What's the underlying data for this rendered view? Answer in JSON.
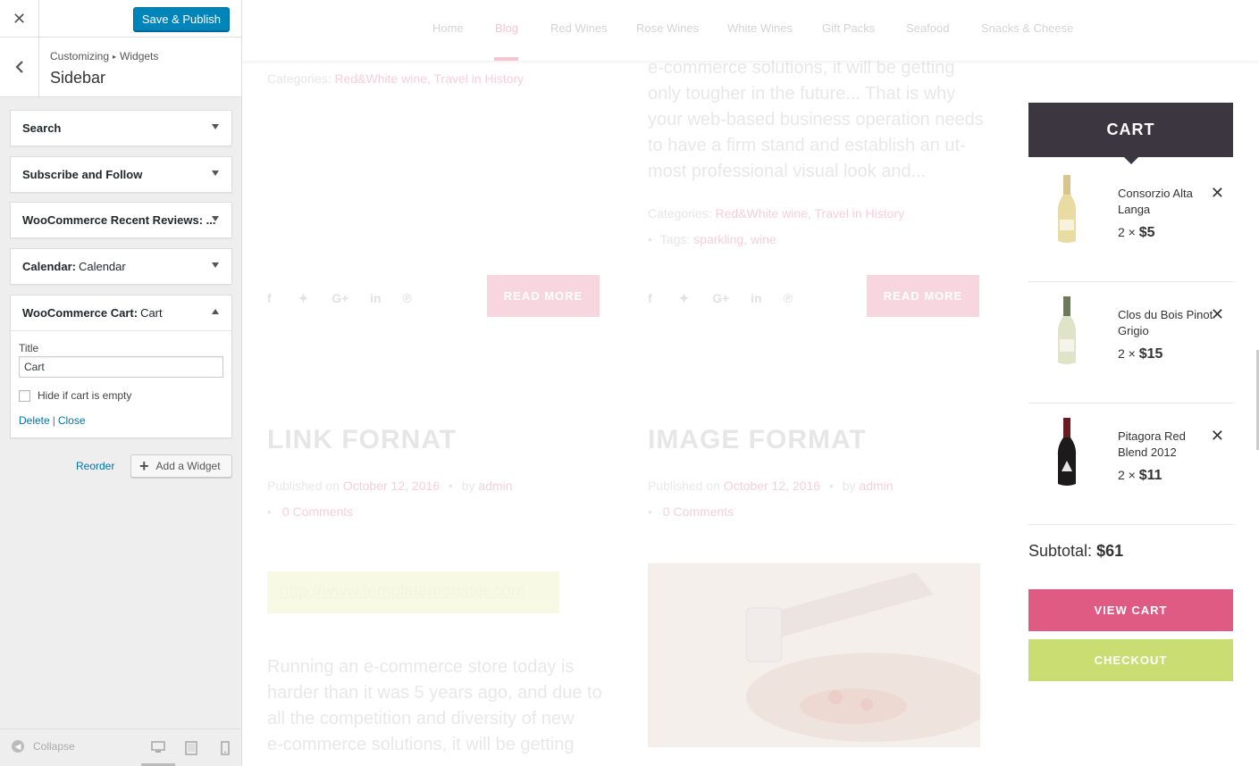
{
  "customizer": {
    "close_icon": "✕",
    "save_label": "Save & Publish",
    "breadcrumb_parent": "Customizing",
    "breadcrumb_child": "Widgets",
    "section_title": "Sidebar",
    "widgets": [
      {
        "title": "Search",
        "sub": ""
      },
      {
        "title": "Subscribe and Follow",
        "sub": ""
      },
      {
        "title": "WooCommerce Recent Reviews: ...",
        "sub": ""
      },
      {
        "title": "Calendar:",
        "sub": "Calendar"
      },
      {
        "title": "WooCommerce Cart:",
        "sub": "Cart"
      }
    ],
    "cart_widget": {
      "title_label": "Title",
      "title_value": "Cart",
      "hide_label": "Hide if cart is empty",
      "delete_label": "Delete",
      "sep": "|",
      "close_label": "Close"
    },
    "reorder_label": "Reorder",
    "add_widget_label": "Add a Widget",
    "collapse_label": "Collapse"
  },
  "nav": {
    "items": [
      "Home",
      "Blog",
      "Red Wines",
      "Rose Wines",
      "White Wines",
      "Gift Packs",
      "Seafood",
      "Snacks & Cheese"
    ],
    "active": "Blog"
  },
  "posts": {
    "left_top": {
      "categories_label": "Categories:",
      "categories": "Red&White wine, Travel in History",
      "read_more": "READ MORE"
    },
    "right_top": {
      "excerpt_lines": [
        "e-commerce solutions, it will be getting",
        "only tougher in the future... That is why",
        "your web-based business operation needs",
        "to have a firm stand and establish an ut-",
        "most professional visual look and..."
      ],
      "categories_label": "Categories:",
      "categories": "Red&White wine, Travel in History",
      "tags_label": "Tags:",
      "tags": "sparkling, wine",
      "read_more": "READ MORE"
    },
    "link_post": {
      "title": "LINK FORNAT",
      "published_label": "Published on",
      "date": "October 12, 2016",
      "by_label": "by",
      "author": "admin",
      "comments": "0 Comments",
      "link": "http://www.templatemonster.com",
      "excerpt_lines": [
        "Running an e-commerce store today is",
        "harder than it was 5 years ago, and due to",
        "all the competition and diversity of new",
        "e-commerce solutions, it will be getting"
      ]
    },
    "image_post": {
      "title": "IMAGE FORMAT",
      "published_label": "Published on",
      "date": "October 12, 2016",
      "by_label": "by",
      "author": "admin",
      "comments": "0 Comments"
    }
  },
  "cart": {
    "heading": "CART",
    "items": [
      {
        "name": "Consorzio Alta Langa",
        "qty": "2 ×",
        "price": "$5"
      },
      {
        "name": "Clos du Bois Pinot Grigio",
        "qty": "2 ×",
        "price": "$15"
      },
      {
        "name": "Pitagora Red Blend 2012",
        "qty": "2 ×",
        "price": "$11"
      }
    ],
    "remove_icon": "✕",
    "subtotal_label": "Subtotal:",
    "subtotal_value": "$61",
    "view_cart": "VIEW CART",
    "checkout": "CHECKOUT"
  },
  "colors": {
    "wp_blue": "#0085ba",
    "cart_dark": "#3b3640",
    "view_cart": "#df5b84",
    "checkout": "#c9dd72",
    "accent_pink": "#f4c5d3"
  }
}
